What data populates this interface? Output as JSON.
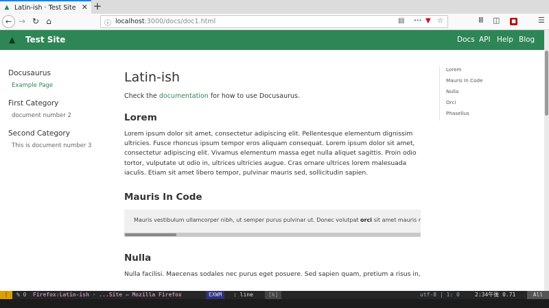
{
  "browser": {
    "tab": {
      "title": "Latin-ish · Test Site",
      "favicon": "docusaurus-icon"
    },
    "url": {
      "host": "localhost",
      "rest": ":3000/docs/doc1.html"
    }
  },
  "site": {
    "title": "Test Site",
    "nav": [
      "Docs",
      "API",
      "Help",
      "Blog"
    ],
    "brand_color": "#2e8555"
  },
  "sidebar": {
    "categories": [
      {
        "title": "Docusaurus",
        "items": [
          "Example Page"
        ]
      },
      {
        "title": "First Category",
        "items": [
          "document number 2"
        ]
      },
      {
        "title": "Second Category",
        "items": [
          "This is document number 3"
        ]
      }
    ]
  },
  "article": {
    "title": "Latin-ish",
    "intro_before": "Check the ",
    "intro_link": "documentation",
    "intro_after": " for how to use Docusaurus.",
    "h_lorem": "Lorem",
    "p_lorem": "Lorem ipsum dolor sit amet, consectetur adipiscing elit. Pellentesque elementum dignissim ultricies. Fusce rhoncus ipsum tempor eros aliquam consequat. Lorem ipsum dolor sit amet, consectetur adipiscing elit. Vivamus elementum massa eget nulla aliquet sagittis. Proin odio tortor, vulputate ut odio in, ultrices ultricies augue. Cras ornare ultrices lorem malesuada iaculis. Etiam sit amet libero tempor, pulvinar mauris sed, sollicitudin sapien.",
    "h_mauris": "Mauris In Code",
    "code_before": "Mauris vestibulum ullamcorper nibh, ut semper purus pulvinar ut. Donec volutpat ",
    "code_bold": "orci",
    "code_after": " sit amet mauris malesuada",
    "h_nulla": "Nulla",
    "p_nulla": "Nulla facilisi. Maecenas sodales nec purus eget posuere. Sed sapien quam, pretium a risus in,"
  },
  "toc": [
    "Lorem",
    "Mauris In Code",
    "Nulla",
    "Orci",
    "Phasellus"
  ],
  "modeline": {
    "percent": "% 0",
    "buffer": "Firefox:Latin-ish · ...Site — Mozilla Firefox",
    "mode": "EXWM",
    "line": ": line",
    "kbd": "[k]",
    "encoding": "utf-8 | 1: 0",
    "time": "2:34午後 0.71",
    "position": "All"
  }
}
